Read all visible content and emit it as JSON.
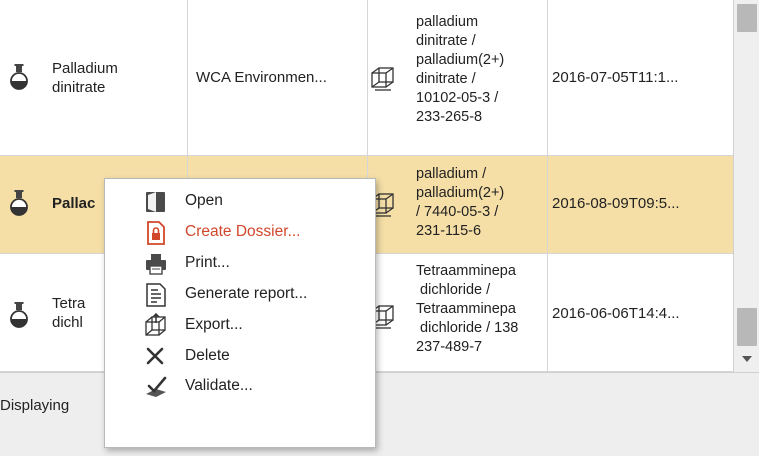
{
  "table": {
    "rows": [
      {
        "name_lines": [
          "Palladium",
          "dinitrate"
        ],
        "owner": "WCA Environmen...",
        "identifiers": "palladium\ndinitrate /\npalladium(2+)\ndinitrate /\n10102-05-3 /\n233-265-8",
        "date": "2016-07-05T11:1...",
        "selected": false
      },
      {
        "name_lines": [
          "Pallac"
        ],
        "owner": "",
        "identifiers": "palladium /\npalladium(2+)\n/ 7440-05-3 /\n231-115-6",
        "date": "2016-08-09T09:5...",
        "selected": true
      },
      {
        "name_lines": [
          "Tetra",
          "dichl"
        ],
        "owner": "",
        "identifiers": "Tetraamminepa\n dichloride /\nTetraamminepa\n dichloride / 138\n237-489-7",
        "date": "2016-06-06T14:4...",
        "selected": false
      }
    ]
  },
  "status": {
    "text": "Displaying"
  },
  "context_menu": {
    "items": [
      {
        "label": "Open",
        "icon": "open-icon"
      },
      {
        "label": "Create Dossier...",
        "icon": "create-dossier-icon",
        "accent": "#d1472b"
      },
      {
        "label": "Print...",
        "icon": "print-icon"
      },
      {
        "label": "Generate report...",
        "icon": "generate-report-icon"
      },
      {
        "label": "Export...",
        "icon": "export-icon"
      },
      {
        "label": "Delete",
        "icon": "delete-icon"
      },
      {
        "label": "Validate...",
        "icon": "validate-icon"
      }
    ]
  },
  "colors": {
    "selected_row": "#f5dfa7",
    "accent": "#d1472b"
  }
}
